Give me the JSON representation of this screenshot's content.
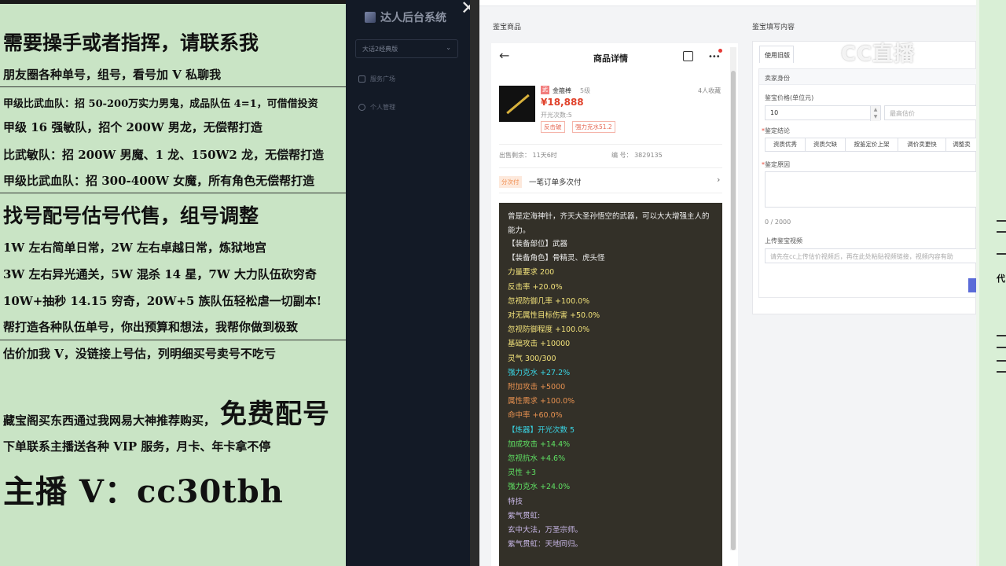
{
  "banner": {
    "line1": "需要操手或者指挥，请联系我",
    "line2": "朋友圈各种单号，组号，看号加 V 私聊我",
    "line3": "甲级比武血队：招 50-200万实力男鬼，成品队伍 4=1，可借借投资",
    "line4": "甲级 16 强敏队，招个 200W 男龙，无偿帮打造",
    "line5": "比武敏队：招 200W 男魔、1 龙、150W2 龙，无偿帮打造",
    "line6": "甲级比武血队：招 300-400W 女魔，所有角色无偿帮打造",
    "line7": "找号配号估号代售，组号调整",
    "line8": "1W 左右简单日常，2W 左右卓越日常，炼狱地宫",
    "line9": "3W 左右异光通关，5W 混杀 14 星，7W 大力队伍砍穷奇",
    "line10": "10W+抽秒 14.15 穷奇，20W+5 族队伍轻松虐一切副本!",
    "line11": "帮打造各种队伍单号，你出预算和想法，我帮你做到极致",
    "line12": "估价加我 V，没链接上号估，列明细买号卖号不吃亏",
    "line13a": "藏宝阁买东西通过我网易大神推荐购买，",
    "line13b": "免费配号",
    "line14": "下单联系主播送各种 VIP 服务，月卡、年卡拿不停",
    "line15": "主播 V：cc30tbh"
  },
  "sidebar": {
    "brand": "达人后台系统",
    "select_value": "大话2经典版",
    "nav": [
      {
        "label": "服务广场"
      },
      {
        "label": "个人管理"
      }
    ]
  },
  "main": {
    "left_panel_title": "鉴宝商品",
    "right_panel_title": "鉴宝填写内容"
  },
  "phone": {
    "title": "商品详情",
    "item": {
      "tag": "武",
      "name": "金箍棒",
      "level": "5级",
      "favorites": "4人收藏",
      "price": "¥18,888",
      "open_count": "开光次数:5",
      "badges": [
        "反击破",
        "强力克水51.2"
      ]
    },
    "sale_left": "出售剩余： 11天6时",
    "serial": "编 号： 3829135",
    "pay_badge": "分次付",
    "pay_text": "一笔订单多次付",
    "desc": "曾是定海神针，齐天大圣孙悟空的武器，可以大大增强主人的能力。",
    "attrs": [
      {
        "text": "【装备部位】武器",
        "color": "white"
      },
      {
        "text": "【装备角色】骨精灵、虎头怪",
        "color": "white"
      },
      {
        "text": "力量要求 200",
        "color": "yellow"
      },
      {
        "text": "反击率 +20.0%",
        "color": "yellow"
      },
      {
        "text": "忽视防御几率 +100.0%",
        "color": "yellow"
      },
      {
        "text": "对无属性目标伤害 +50.0%",
        "color": "yellow"
      },
      {
        "text": "忽视防御程度 +100.0%",
        "color": "yellow"
      },
      {
        "text": "基础攻击 +10000",
        "color": "yellow"
      },
      {
        "text": "灵气 300/300",
        "color": "yellow"
      },
      {
        "text": "强力克水 +27.2%",
        "color": "cyan"
      },
      {
        "text": "附加攻击 +5000",
        "color": "orange"
      },
      {
        "text": "属性需求 +100.0%",
        "color": "orange"
      },
      {
        "text": "命中率 +60.0%",
        "color": "orange"
      },
      {
        "text": " ",
        "color": "white"
      },
      {
        "text": "【炼器】开光次数 5",
        "color": "cyan"
      },
      {
        "text": "加成攻击 +14.4%",
        "color": "green"
      },
      {
        "text": "忽视抗水 +4.6%",
        "color": "green"
      },
      {
        "text": "灵性 +3",
        "color": "green"
      },
      {
        "text": "强力克水 +24.0%",
        "color": "green"
      },
      {
        "text": "特技",
        "color": "purple"
      },
      {
        "text": "紫气贯虹:",
        "color": "purple"
      },
      {
        "text": "玄中大法，万圣宗师。",
        "color": "purple"
      },
      {
        "text": "紫气贯虹：天地同归。",
        "color": "purple"
      }
    ]
  },
  "form": {
    "tab": "使用旧版",
    "section": "卖家身份",
    "price_label": "鉴宝价格(单位元)",
    "price_value": "10",
    "max_placeholder": "最高估价",
    "conclusion_label": "鉴定结论",
    "conclusions": [
      "资质优秀",
      "资质欠缺",
      "按鉴定价上架",
      "调价卖更快",
      "调整卖"
    ],
    "reason_label": "鉴定原因",
    "counter": "0 / 2000",
    "video_label": "上传鉴宝视频",
    "video_placeholder": "请先在cc上传估价视频后，再在此处粘贴视频链接，视频内容有助"
  },
  "watermark": "CC直播",
  "right_edge_text": "代"
}
